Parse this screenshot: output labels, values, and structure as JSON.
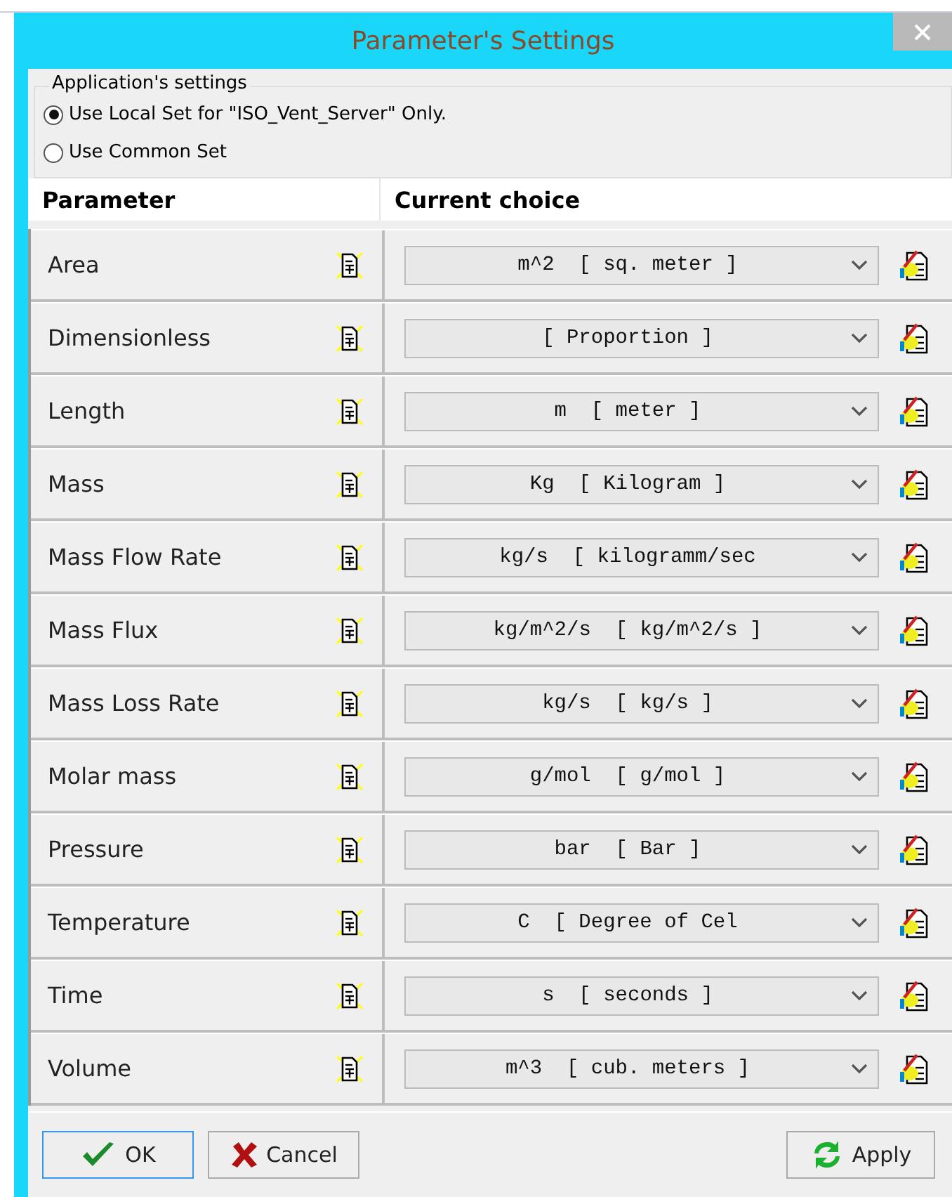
{
  "window": {
    "title": "Parameter's Settings"
  },
  "settings_group": {
    "label": "Application's settings",
    "options": [
      {
        "label": "Use Local Set for \"ISO_Vent_Server\" Only.",
        "selected": true
      },
      {
        "label": "Use Common Set",
        "selected": false
      }
    ]
  },
  "table": {
    "columns": [
      "Parameter",
      "Current choice"
    ],
    "rows": [
      {
        "parameter": "Area",
        "choice": "m^2  [ sq. meter ]"
      },
      {
        "parameter": "Dimensionless",
        "choice": "[ Proportion ]"
      },
      {
        "parameter": "Length",
        "choice": "m  [ meter ]"
      },
      {
        "parameter": "Mass",
        "choice": "Kg  [ Kilogram ]"
      },
      {
        "parameter": "Mass Flow Rate",
        "choice": "kg/s  [ kilogramm/sec"
      },
      {
        "parameter": "Mass Flux",
        "choice": "kg/m^2/s  [ kg/m^2/s ]"
      },
      {
        "parameter": "Mass Loss Rate",
        "choice": "kg/s  [ kg/s ]"
      },
      {
        "parameter": "Molar mass",
        "choice": "g/mol  [ g/mol ]"
      },
      {
        "parameter": "Pressure",
        "choice": "bar  [ Bar ]"
      },
      {
        "parameter": "Temperature",
        "choice": "C  [ Degree of Cel"
      },
      {
        "parameter": "Time",
        "choice": "s  [ seconds ]"
      },
      {
        "parameter": "Volume",
        "choice": "m^3  [ cub. meters ]"
      }
    ]
  },
  "buttons": [
    {
      "label": "OK",
      "kind": "ok"
    },
    {
      "label": "Cancel",
      "kind": "cancel"
    },
    {
      "label": "Apply",
      "kind": "apply"
    }
  ]
}
